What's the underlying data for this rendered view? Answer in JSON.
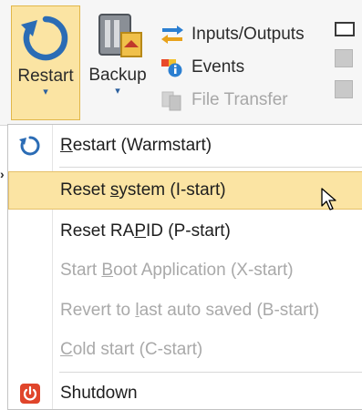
{
  "ribbon": {
    "restart": {
      "label": "Restart",
      "arrow": "▾"
    },
    "backup": {
      "label": "Backup",
      "arrow": "▾"
    },
    "small_items": [
      {
        "label": "Inputs/Outputs",
        "icon": "io-arrows-icon",
        "disabled": false
      },
      {
        "label": "Events",
        "icon": "events-icon",
        "disabled": false
      },
      {
        "label": "File Transfer",
        "icon": "file-transfer-icon",
        "disabled": true
      }
    ]
  },
  "menu": {
    "items": [
      {
        "pre": "",
        "ul": "R",
        "post": "estart (Warmstart)",
        "icon": "restart-icon",
        "disabled": false,
        "hover": false
      },
      {
        "pre": "Reset ",
        "ul": "s",
        "post": "ystem (I-start)",
        "icon": "",
        "disabled": false,
        "hover": true
      },
      {
        "pre": "Reset RA",
        "ul": "P",
        "post": "ID (P-start)",
        "icon": "",
        "disabled": false,
        "hover": false
      },
      {
        "pre": "Start ",
        "ul": "B",
        "post": "oot Application (X-start)",
        "icon": "",
        "disabled": true,
        "hover": false
      },
      {
        "pre": "Revert to ",
        "ul": "l",
        "post": "ast auto saved (B-start)",
        "icon": "",
        "disabled": true,
        "hover": false
      },
      {
        "pre": "",
        "ul": "C",
        "post": "old start (C-start)",
        "icon": "",
        "disabled": true,
        "hover": false
      },
      {
        "pre": "Shutdown",
        "ul": "",
        "post": "",
        "icon": "shutdown-icon",
        "disabled": false,
        "hover": false
      }
    ]
  },
  "colors": {
    "hover_bg": "#fbe4a3",
    "accent_blue": "#2b5f9e",
    "shutdown_red": "#e0452b",
    "disabled_text": "#a9a9a9"
  }
}
